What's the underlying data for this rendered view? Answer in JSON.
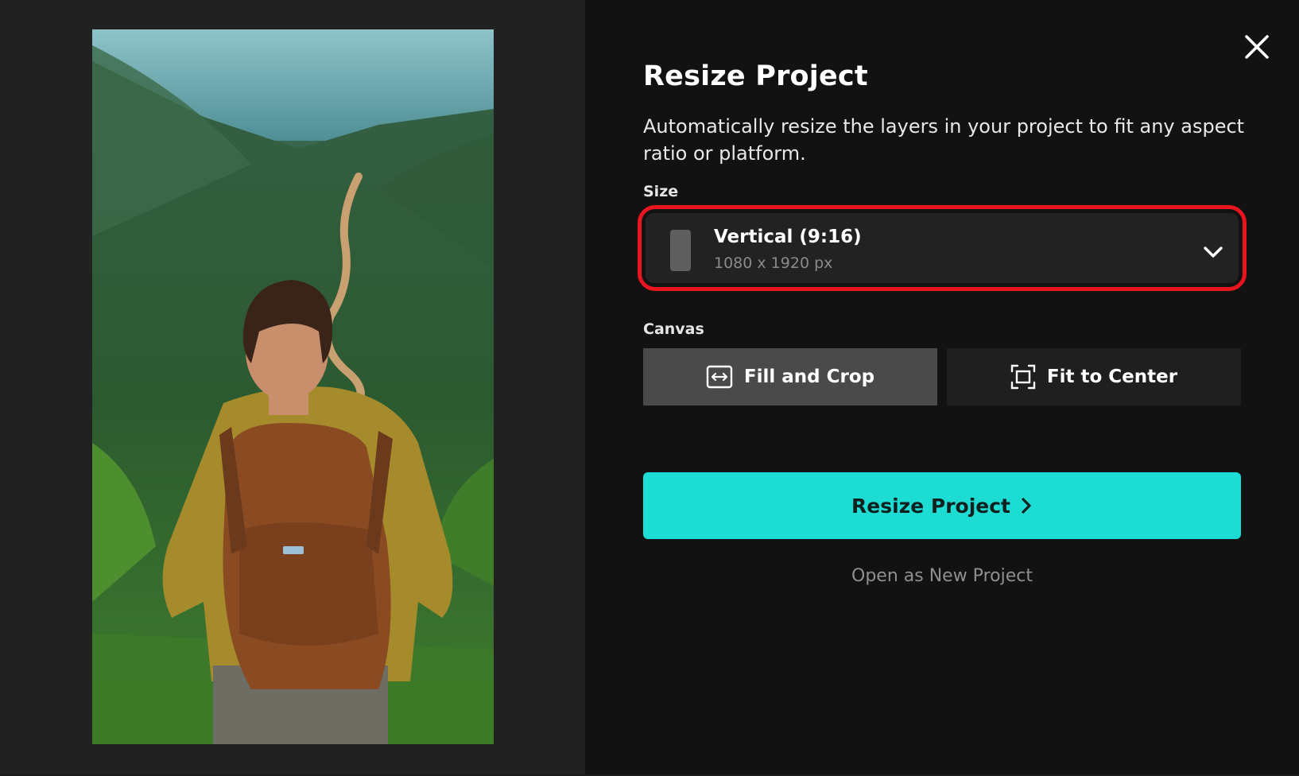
{
  "dialog": {
    "title": "Resize Project",
    "description": "Automatically resize the layers in your project to fit any aspect ratio or platform.",
    "close_icon": "close-icon"
  },
  "size": {
    "label": "Size",
    "selected_title": "Vertical (9:16)",
    "selected_dimensions": "1080 x 1920 px",
    "icon": "phone-portrait-icon",
    "highlight_color": "#e8141e"
  },
  "canvas": {
    "label": "Canvas",
    "options": [
      {
        "label": "Fill and Crop",
        "icon": "fill-crop-icon",
        "selected": true
      },
      {
        "label": "Fit to Center",
        "icon": "fit-center-icon",
        "selected": false
      }
    ]
  },
  "actions": {
    "primary_label": "Resize Project",
    "primary_color": "#1cdcd4",
    "secondary_label": "Open as New Project"
  },
  "preview": {
    "subject": "hiker-with-backpack-overlooking-forest-valley"
  }
}
